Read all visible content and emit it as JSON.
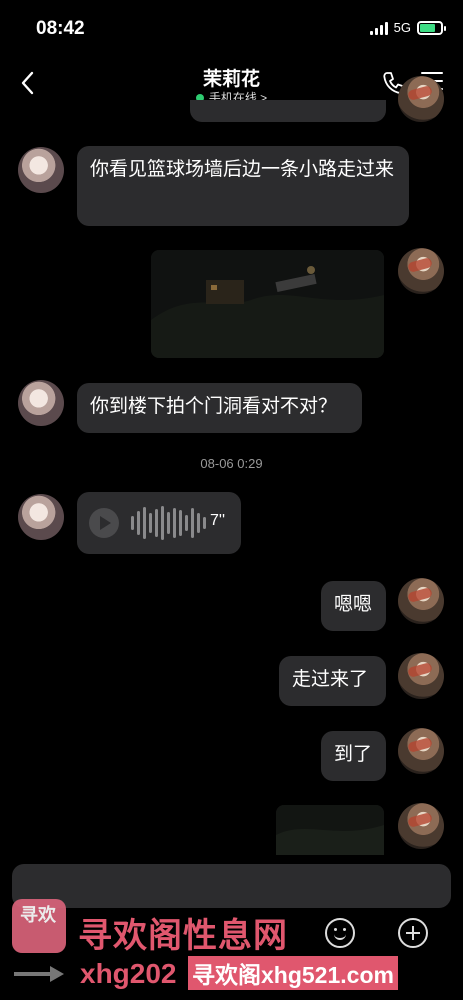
{
  "status_bar": {
    "time": "08:42",
    "network": "5G"
  },
  "header": {
    "contact_name": "茉莉花",
    "presence": "手机在线 >"
  },
  "messages": [
    {
      "side": "left",
      "text": "你看见篮球场墙后边一条小路走过来"
    },
    {
      "side": "right",
      "type": "image"
    },
    {
      "side": "left",
      "text": "你到楼下拍个门洞看对不对？"
    },
    {
      "type": "timestamp",
      "text": "08-06 0:29"
    },
    {
      "side": "left",
      "type": "voice",
      "duration": "7''"
    },
    {
      "side": "right",
      "text": "嗯嗯"
    },
    {
      "side": "right",
      "text": "走过来了"
    },
    {
      "side": "right",
      "text": "到了"
    },
    {
      "side": "right",
      "type": "image"
    }
  ],
  "watermark": {
    "logo_text": "寻欢",
    "brand": "寻欢阁性息网",
    "url_prefix": "xhg202",
    "url_badge": "寻欢阁xhg521.com"
  }
}
